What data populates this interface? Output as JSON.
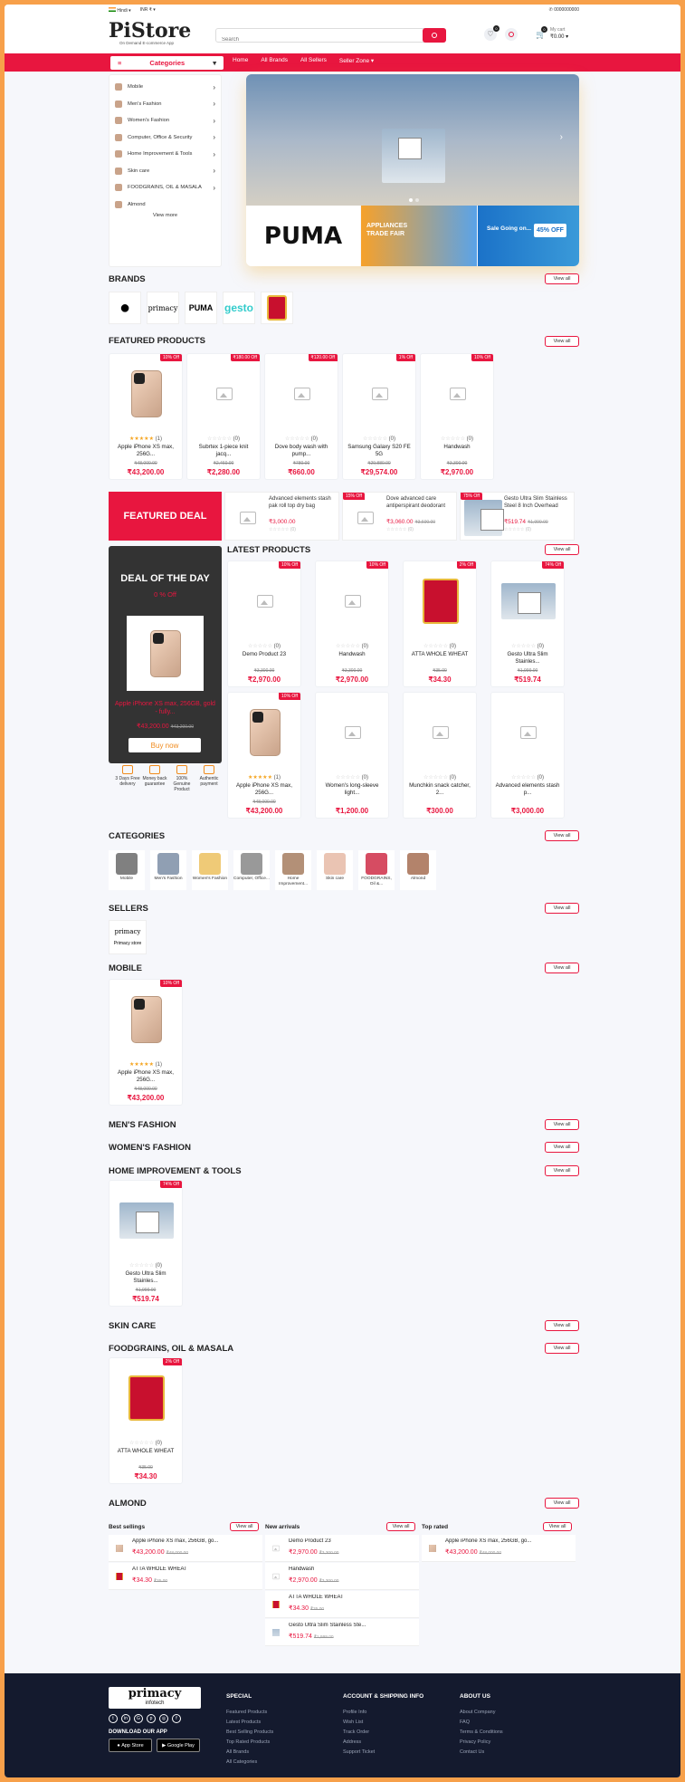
{
  "topbar": {
    "lang": "Hindi",
    "currency": "INR ₹",
    "phone": "0000000000"
  },
  "header": {
    "logo": "PiStore",
    "tagline": "On Demand E-commerce App",
    "search_placeholder": "Search",
    "wishlist_count": "0",
    "compare_count": "0",
    "cart_count": "0",
    "cart_label": "My cart",
    "cart_total": "₹0.00"
  },
  "nav": {
    "categories": "Categories",
    "links": [
      "Home",
      "All Brands",
      "All Sellers",
      "Seller Zone"
    ]
  },
  "sidebar": {
    "items": [
      "Mobile",
      "Men's Fashion",
      "Women's Fashion",
      "Computer, Office & Security",
      "Home Improvement & Tools",
      "Skin care",
      "FOODGRAINS, OIL & MASALA",
      "Almond"
    ],
    "view_more": "View more"
  },
  "banner": {
    "puma": "PUMA",
    "appliances": "APPLIANCES TRADE FAIR",
    "sale": "Sale Going on...",
    "off": "45% OFF"
  },
  "brands": {
    "title": "BRANDS",
    "view_all": "View all",
    "items": [
      "apple",
      "primacy",
      "puma",
      "gesto",
      "atta"
    ]
  },
  "featured": {
    "title": "FEATURED PRODUCTS",
    "view_all": "View all",
    "products": [
      {
        "badge": "10% Off",
        "name": "Apple iPhone XS max, 256G...",
        "rating": "(1)",
        "old": "₹48,000.00",
        "price": "₹43,200.00",
        "img": "phone"
      },
      {
        "badge": "₹180.00 Off",
        "name": "Subrtex 1-piece knit jacq...",
        "rating": "(0)",
        "old": "₹2,460.00",
        "price": "₹2,280.00",
        "img": "ph"
      },
      {
        "badge": "₹120.00 Off",
        "name": "Dove body wash with pump...",
        "rating": "(0)",
        "old": "₹780.00",
        "price": "₹660.00",
        "img": "ph"
      },
      {
        "badge": "1% Off",
        "name": "Samsung Galaxy S20 FE 5G",
        "rating": "(0)",
        "old": "₹29,880.00",
        "price": "₹29,574.00",
        "img": "ph"
      },
      {
        "badge": "10% Off",
        "name": "Handwash",
        "rating": "(0)",
        "old": "₹3,300.00",
        "price": "₹2,970.00",
        "img": "ph"
      }
    ]
  },
  "featured_deal": {
    "title": "FEATURED DEAL",
    "items": [
      {
        "name": "Advanced elements stash pak roll top dry bag",
        "price": "₹3,000.00",
        "rating": "(0)"
      },
      {
        "badge": "15% Off",
        "name": "Dove advanced care antiperspirant deodorant",
        "price": "₹3,060.00",
        "old": "₹3,600.00",
        "rating": "(0)"
      },
      {
        "badge": "75% Off",
        "name": "Gesto Ultra Slim Stainless Steel 8 Inch Overhead",
        "price": "₹519.74",
        "old": "₹1,999.00",
        "rating": "(0)"
      }
    ]
  },
  "deal_of_day": {
    "title": "DEAL OF THE DAY",
    "off": "0 % Off",
    "name": "Apple iPhone XS max, 256GB, gold - fully...",
    "price": "₹43,200.00",
    "old": "₹43,200.00",
    "button": "Buy now"
  },
  "features": [
    "3 Days Free delivery",
    "Money back guarantee",
    "100% Genuine Product",
    "Authentic payment"
  ],
  "latest": {
    "title": "LATEST PRODUCTS",
    "view_all": "View all",
    "products": [
      {
        "badge": "10% Off",
        "name": "Demo Product 23",
        "rating": "(0)",
        "old": "₹3,300.00",
        "price": "₹2,970.00",
        "img": "ph"
      },
      {
        "badge": "10% Off",
        "name": "Handwash",
        "rating": "(0)",
        "old": "₹3,300.00",
        "price": "₹2,970.00",
        "img": "ph"
      },
      {
        "badge": "2% Off",
        "name": "ATTA WHOLE WHEAT",
        "rating": "(0)",
        "old": "₹35.00",
        "price": "₹34.30",
        "img": "atta"
      },
      {
        "badge": "74% Off",
        "name": "Gesto Ultra Slim Stainles...",
        "rating": "(0)",
        "old": "₹1,999.00",
        "price": "₹519.74",
        "img": "house"
      },
      {
        "badge": "10% Off",
        "name": "Apple iPhone XS max, 256G...",
        "rating": "(1)",
        "old": "₹48,000.00",
        "price": "₹43,200.00",
        "img": "phone"
      },
      {
        "name": "Women's long-sleeve light...",
        "rating": "(0)",
        "price": "₹1,200.00",
        "img": "ph"
      },
      {
        "name": "Munchkin snack catcher, 2...",
        "rating": "(0)",
        "price": "₹300.00",
        "img": "ph"
      },
      {
        "name": "Advanced elements stash p...",
        "rating": "(0)",
        "price": "₹3,000.00",
        "img": "ph"
      }
    ]
  },
  "categories": {
    "title": "CATEGORIES",
    "view_all": "View all",
    "items": [
      "Mobile",
      "Men's Fashion",
      "Women's Fashion",
      "Computer, Office...",
      "Home Improvement...",
      "Skin care",
      "FOODGRAINS, Oil &...",
      "Almond"
    ]
  },
  "sellers": {
    "title": "SELLERS",
    "view_all": "View all",
    "items": [
      "Primacy store"
    ]
  },
  "mobile": {
    "title": "MOBILE",
    "view_all": "View all",
    "product": {
      "badge": "10% Off",
      "name": "Apple iPhone XS max, 256G...",
      "rating": "(1)",
      "old": "₹48,000.00",
      "price": "₹43,200.00"
    }
  },
  "mens": {
    "title": "MEN'S FASHION",
    "view_all": "View all"
  },
  "womens": {
    "title": "WOMEN'S FASHION",
    "view_all": "View all"
  },
  "home_imp": {
    "title": "HOME IMPROVEMENT & TOOLS",
    "view_all": "View all",
    "product": {
      "badge": "74% Off",
      "name": "Gesto Ultra Slim Stainles...",
      "rating": "(0)",
      "old": "₹1,999.00",
      "price": "₹519.74"
    }
  },
  "skin": {
    "title": "SKIN CARE",
    "view_all": "View all"
  },
  "food": {
    "title": "FOODGRAINS, OIL & MASALA",
    "view_all": "View all",
    "product": {
      "badge": "2% Off",
      "name": "ATTA WHOLE WHEAT",
      "rating": "(0)",
      "old": "₹35.00",
      "price": "₹34.30"
    }
  },
  "almond": {
    "title": "ALMOND",
    "view_all": "View all"
  },
  "lists": [
    {
      "title": "Best sellings",
      "view_all": "View all",
      "items": [
        {
          "name": "Apple iPhone XS max, 256GB, go...",
          "price": "₹43,200.00",
          "old": "₹48,000.00",
          "img": "phone"
        },
        {
          "name": "ATTA WHOLE WHEAT",
          "price": "₹34.30",
          "old": "₹35.00",
          "img": "atta"
        }
      ]
    },
    {
      "title": "New arrivals",
      "view_all": "View all",
      "items": [
        {
          "name": "Demo Product 23",
          "price": "₹2,970.00",
          "old": "₹3,300.00",
          "img": "ph"
        },
        {
          "name": "Handwash",
          "price": "₹2,970.00",
          "old": "₹3,300.00",
          "img": "ph"
        },
        {
          "name": "ATTA WHOLE WHEAT",
          "price": "₹34.30",
          "old": "₹35.00",
          "img": "atta"
        },
        {
          "name": "Gesto Ultra Slim Stainless Ste...",
          "price": "₹519.74",
          "old": "₹1,999.00",
          "img": "house"
        }
      ]
    },
    {
      "title": "Top rated",
      "view_all": "View all",
      "items": [
        {
          "name": "Apple iPhone XS max, 256GB, go...",
          "price": "₹43,200.00",
          "old": "₹48,000.00",
          "img": "phone"
        }
      ]
    }
  ],
  "footer": {
    "logo": "primacy",
    "logo_sub": "infotech",
    "download": "DOWNLOAD OUR APP",
    "appstore": "App Store",
    "playstore": "Google Play",
    "cols": [
      {
        "title": "SPECIAL",
        "links": [
          "Featured Products",
          "Latest Products",
          "Best Selling Products",
          "Top Rated Products",
          "All Brands",
          "All Categories"
        ]
      },
      {
        "title": "ACCOUNT & SHIPPING INFO",
        "links": [
          "Profile Info",
          "Wish List",
          "Track Order",
          "Address",
          "Support Ticket"
        ]
      },
      {
        "title": "ABOUT US",
        "links": [
          "About Company",
          "FAQ",
          "Terms & Conditions",
          "Privacy Policy",
          "Contact Us"
        ]
      }
    ]
  }
}
